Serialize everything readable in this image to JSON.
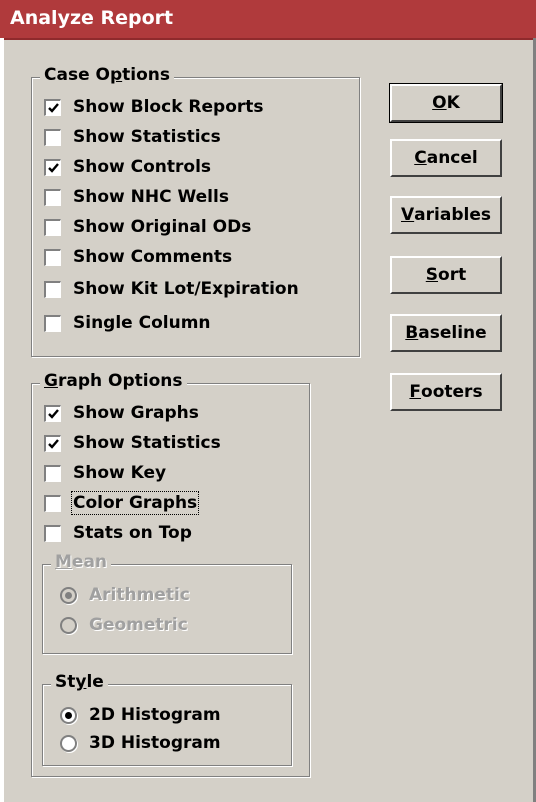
{
  "window": {
    "title": "Analyze Report"
  },
  "case_options": {
    "legend_pre": "Case O",
    "legend_accel": "p",
    "legend_post": "tions",
    "items": [
      {
        "label": "Show Block Reports",
        "checked": true
      },
      {
        "label": "Show Statistics",
        "checked": false
      },
      {
        "label": "Show Controls",
        "checked": true
      },
      {
        "label": "Show NHC Wells",
        "checked": false
      },
      {
        "label": "Show Original ODs",
        "checked": false
      },
      {
        "label": "Show Comments",
        "checked": false
      },
      {
        "label": "Show Kit Lot/Expiration",
        "checked": false
      },
      {
        "label": "Single Column",
        "checked": false
      }
    ]
  },
  "graph_options": {
    "legend_accel": "G",
    "legend_post": "raph Options",
    "items": [
      {
        "label": "Show Graphs",
        "checked": true
      },
      {
        "label": "Show Statistics",
        "checked": true
      },
      {
        "label": "Show Key",
        "checked": false
      },
      {
        "label": "Color Graphs",
        "checked": false,
        "focused": true
      },
      {
        "label": "Stats on Top",
        "checked": false
      }
    ],
    "mean": {
      "legend_accel": "M",
      "legend_post": "ean",
      "enabled": false,
      "options": [
        {
          "label": "Arithmetic",
          "selected": true
        },
        {
          "label": "Geometric",
          "selected": false
        }
      ]
    },
    "style": {
      "legend_pre": "St",
      "legend_accel": "y",
      "legend_post": "le",
      "options": [
        {
          "label": "2D Histogram",
          "selected": true
        },
        {
          "label": "3D Histogram",
          "selected": false
        }
      ]
    }
  },
  "buttons": {
    "ok": {
      "accel": "O",
      "rest": "K"
    },
    "cancel": {
      "accel": "C",
      "rest": "ancel"
    },
    "variables": {
      "accel": "V",
      "rest": "ariables"
    },
    "sort": {
      "accel": "S",
      "rest": "ort"
    },
    "baseline": {
      "accel": "B",
      "rest": "aseline"
    },
    "footers": {
      "accel": "F",
      "rest": "ooters"
    }
  }
}
